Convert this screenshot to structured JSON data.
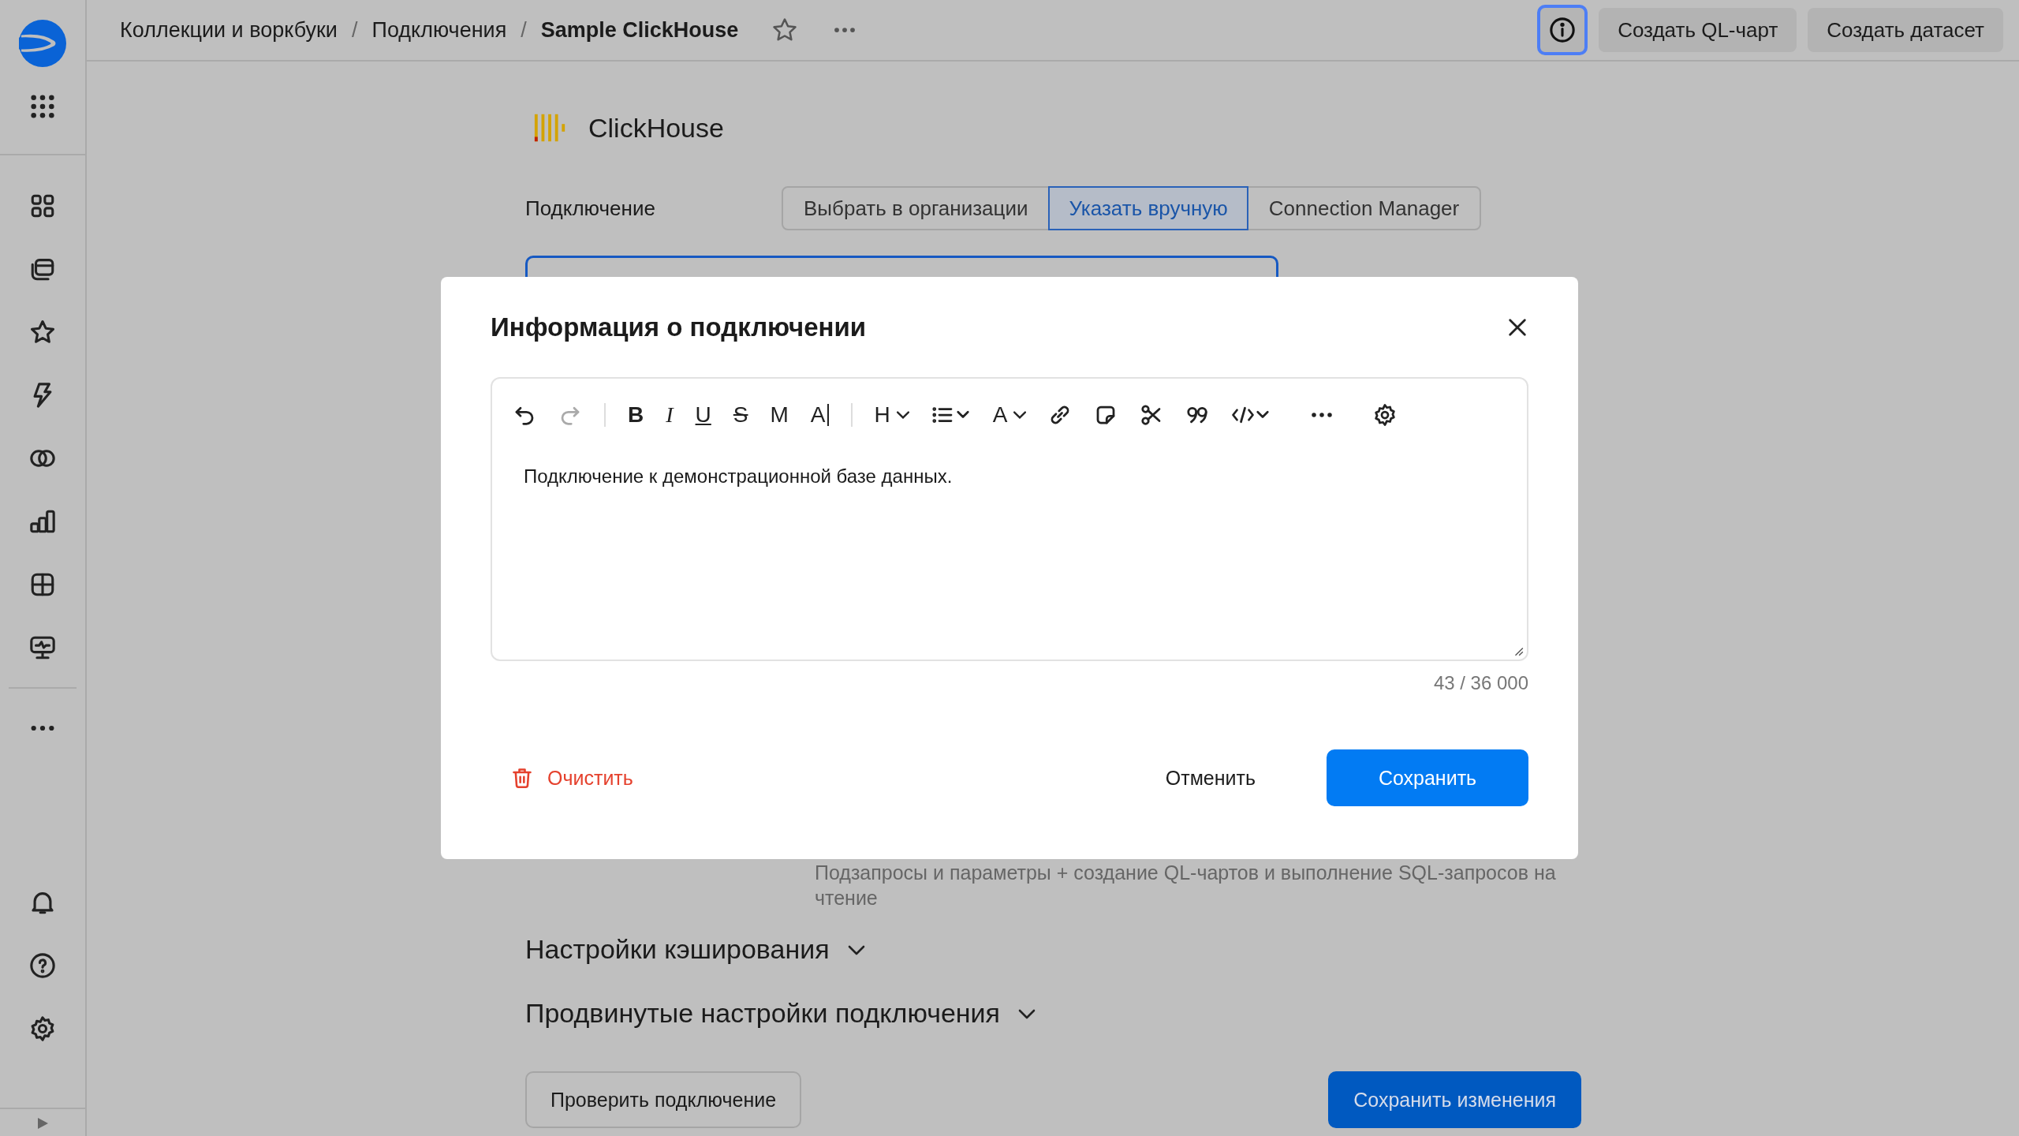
{
  "breadcrumbs": [
    {
      "kind": "link",
      "text": "Коллекции и воркбуки"
    },
    {
      "kind": "separator",
      "text": "/"
    },
    {
      "kind": "link",
      "text": "Подключения"
    },
    {
      "kind": "separator",
      "text": "/"
    },
    {
      "kind": "current",
      "text": "Sample ClickHouse"
    }
  ],
  "header_buttons": [
    "Создать QL-чарт",
    "Создать датасет"
  ],
  "connector": {
    "title": "ClickHouse"
  },
  "connection": {
    "label": "Подключение",
    "options": [
      {
        "label": "Выбрать в организации",
        "selected": false
      },
      {
        "label": "Указать вручную",
        "selected": true
      },
      {
        "label": "Connection Manager",
        "selected": false
      }
    ]
  },
  "permissions_note": "Подзапросы и параметры + создание QL-чартов и выполнение SQL-запросов на чтение",
  "sections": [
    {
      "title": "Настройки кэширования",
      "expanded": false
    },
    {
      "title": "Продвинутые настройки подключения",
      "expanded": false
    }
  ],
  "actions": [
    {
      "kind": "secondary",
      "label": "Проверить подключение"
    },
    {
      "kind": "primary",
      "label": "Сохранить изменения"
    }
  ],
  "dialog": {
    "title": "Информация о подключении",
    "toolbar_letters": [
      "B",
      "I",
      "U",
      "S",
      "M",
      "A",
      "H",
      "A"
    ],
    "text": "Подключение к демонстрационной базе данных.",
    "counter": "43 / 36 000",
    "clear": "Очистить",
    "cancel": "Отменить",
    "save": "Сохранить"
  }
}
